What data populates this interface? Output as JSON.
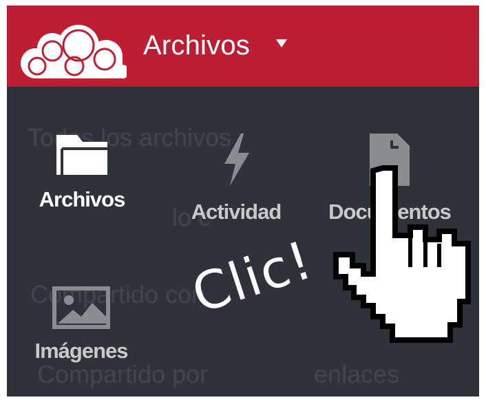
{
  "header": {
    "app_title": "Archivos",
    "caret_icon": "caret-down-icon",
    "logo_icon": "owncloud-cloud-logo",
    "color": "#bd1e34"
  },
  "menu": {
    "background": "#2f3238",
    "apps": [
      {
        "label": "Archivos",
        "icon": "folder-icon",
        "active": true
      },
      {
        "label": "Actividad",
        "icon": "lightning-icon",
        "active": false
      },
      {
        "label": "Documentos",
        "icon": "document-icon",
        "active": false
      },
      {
        "label": "Imágenes",
        "icon": "image-icon",
        "active": false
      }
    ],
    "background_text": [
      "Todos los archivos",
      "lo c",
      "Compartido con",
      "Compartido por",
      "enlaces"
    ]
  },
  "overlay": {
    "annotation": "Clic!",
    "cursor_icon": "hand-pointer-icon"
  }
}
